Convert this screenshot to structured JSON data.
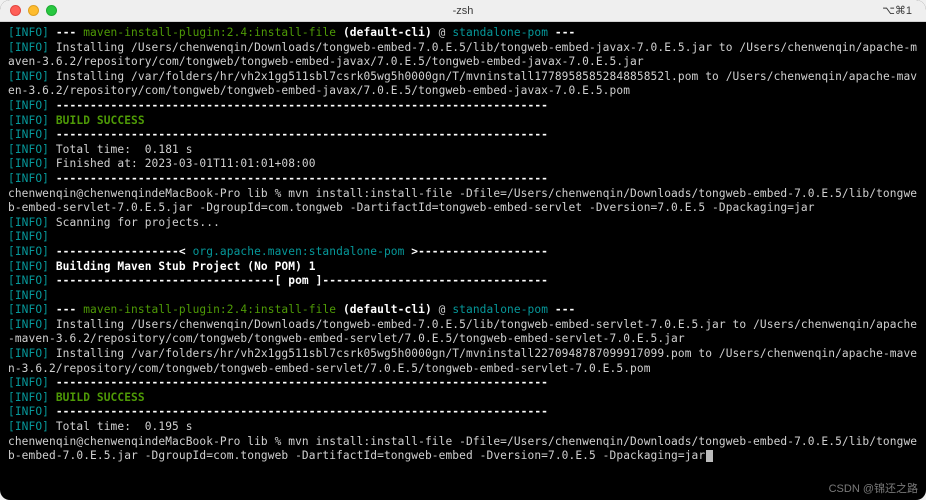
{
  "window": {
    "title": "-zsh",
    "rightIndicator": "⌥⌘1"
  },
  "colors": {
    "info": "#06989a",
    "plugin": "#4e9a06",
    "success": "#4e9a06"
  },
  "infoLabel": "[INFO]",
  "lines": [
    {
      "type": "plugin",
      "prefix": "--- ",
      "plugin": "maven-install-plugin:2.4:install-file",
      "goalpre": " (default-cli)",
      " at": " @ ",
      "pom": "standalone-pom",
      "suffix": " ---"
    },
    {
      "type": "info",
      "text": " Installing /Users/chenwenqin/Downloads/tongweb-embed-7.0.E.5/lib/tongweb-embed-javax-7.0.E.5.jar to /Users/chenwenqin/apache-maven-3.6.2/repository/com/tongweb/tongweb-embed-javax/7.0.E.5/tongweb-embed-javax-7.0.E.5.jar"
    },
    {
      "type": "info",
      "text": " Installing /var/folders/hr/vh2x1gg511sbl7csrk05wg5h0000gn/T/mvninstall1778958585284885852l.pom to /Users/chenwenqin/apache-maven-3.6.2/repository/com/tongweb/tongweb-embed-javax/7.0.E.5/tongweb-embed-javax-7.0.E.5.pom"
    },
    {
      "type": "info",
      "bold": true,
      "text": " ------------------------------------------------------------------------"
    },
    {
      "type": "success",
      "text": " BUILD SUCCESS"
    },
    {
      "type": "info",
      "bold": true,
      "text": " ------------------------------------------------------------------------"
    },
    {
      "type": "info",
      "text": " Total time:  0.181 s"
    },
    {
      "type": "info",
      "text": " Finished at: 2023-03-01T11:01:01+08:00"
    },
    {
      "type": "info",
      "bold": true,
      "text": " ------------------------------------------------------------------------"
    },
    {
      "type": "prompt",
      "text": "chenwenqin@chenwenqindeMacBook-Pro lib % mvn install:install-file -Dfile=/Users/chenwenqin/Downloads/tongweb-embed-7.0.E.5/lib/tongweb-embed-servlet-7.0.E.5.jar -DgroupId=com.tongweb -DartifactId=tongweb-embed-servlet -Dversion=7.0.E.5 -Dpackaging=jar"
    },
    {
      "type": "info",
      "text": " Scanning for projects..."
    },
    {
      "type": "info-empty"
    },
    {
      "type": "section",
      "pre": " ------------------< ",
      "mid": "org.apache.maven:standalone-pom",
      "post": " >-------------------"
    },
    {
      "type": "info",
      "bold": true,
      "text": " Building Maven Stub Project (No POM) 1"
    },
    {
      "type": "info",
      "bold": true,
      "text": " --------------------------------[ pom ]---------------------------------"
    },
    {
      "type": "info-empty"
    },
    {
      "type": "plugin",
      "prefix": "--- ",
      "plugin": "maven-install-plugin:2.4:install-file",
      "goalpre": " (default-cli)",
      " at": " @ ",
      "pom": "standalone-pom",
      "suffix": " ---"
    },
    {
      "type": "info",
      "text": " Installing /Users/chenwenqin/Downloads/tongweb-embed-7.0.E.5/lib/tongweb-embed-servlet-7.0.E.5.jar to /Users/chenwenqin/apache-maven-3.6.2/repository/com/tongweb/tongweb-embed-servlet/7.0.E.5/tongweb-embed-servlet-7.0.E.5.jar"
    },
    {
      "type": "info",
      "text": " Installing /var/folders/hr/vh2x1gg511sbl7csrk05wg5h0000gn/T/mvninstall2270948787099917099.pom to /Users/chenwenqin/apache-maven-3.6.2/repository/com/tongweb/tongweb-embed-servlet/7.0.E.5/tongweb-embed-servlet-7.0.E.5.pom"
    },
    {
      "type": "info",
      "bold": true,
      "text": " ------------------------------------------------------------------------"
    },
    {
      "type": "success",
      "text": " BUILD SUCCESS"
    },
    {
      "type": "info",
      "bold": true,
      "text": " ------------------------------------------------------------------------"
    },
    {
      "type": "info",
      "text": " Total time:  0.195 s"
    },
    {
      "type": "prompt-cursor",
      "text": "chenwenqin@chenwenqindeMacBook-Pro lib % mvn install:install-file -Dfile=/Users/chenwenqin/Downloads/tongweb-embed-7.0.E.5/lib/tongweb-embed-7.0.E.5.jar -DgroupId=com.tongweb -DartifactId=tongweb-embed -Dversion=7.0.E.5 -Dpackaging=jar"
    }
  ],
  "watermark": "CSDN @锦还之路"
}
